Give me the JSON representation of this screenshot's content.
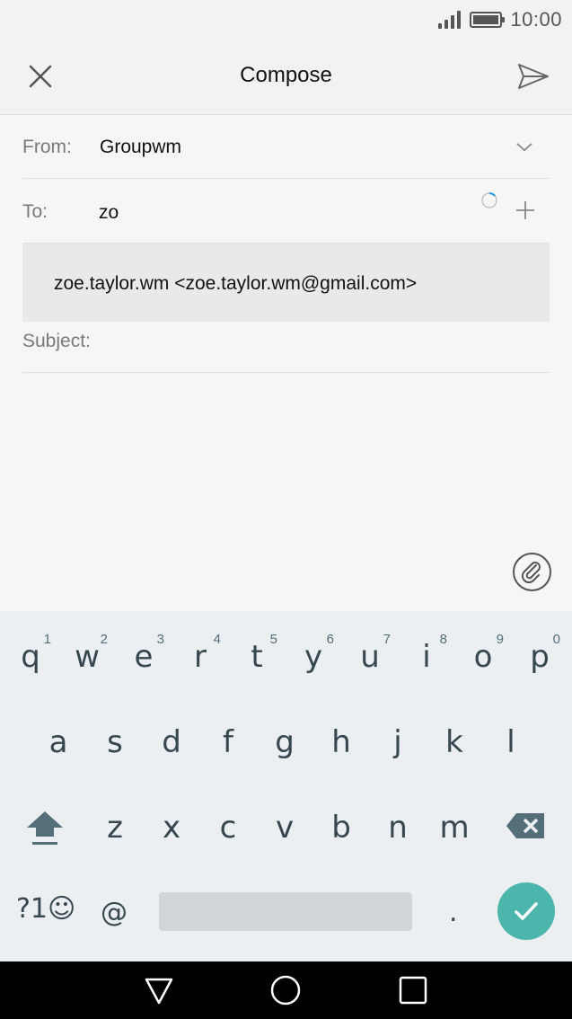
{
  "status_bar": {
    "time": "10:00"
  },
  "header": {
    "title": "Compose"
  },
  "form": {
    "from_label": "From:",
    "from_value": "Groupwm",
    "to_label": "To:",
    "to_value": "zo",
    "suggestion": "zoe.taylor.wm <zoe.taylor.wm@gmail.com>",
    "subject_label": "Subject:"
  },
  "keyboard": {
    "row1": [
      {
        "key": "q",
        "hint": "1"
      },
      {
        "key": "w",
        "hint": "2"
      },
      {
        "key": "e",
        "hint": "3"
      },
      {
        "key": "r",
        "hint": "4"
      },
      {
        "key": "t",
        "hint": "5"
      },
      {
        "key": "y",
        "hint": "6"
      },
      {
        "key": "u",
        "hint": "7"
      },
      {
        "key": "i",
        "hint": "8"
      },
      {
        "key": "o",
        "hint": "9"
      },
      {
        "key": "p",
        "hint": "0"
      }
    ],
    "row2": [
      "a",
      "s",
      "d",
      "f",
      "g",
      "h",
      "j",
      "k",
      "l"
    ],
    "row3": [
      "z",
      "x",
      "c",
      "v",
      "b",
      "n",
      "m"
    ],
    "symbols_label": "?1☺",
    "at_label": "@",
    "period_label": ".",
    "accent_color": "#4db6ac"
  }
}
